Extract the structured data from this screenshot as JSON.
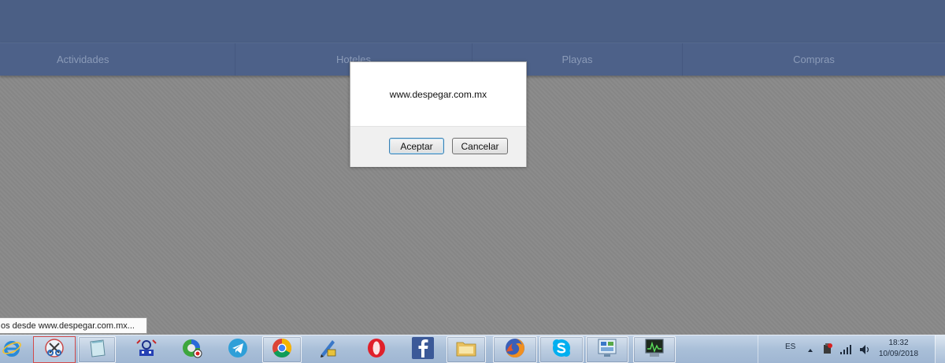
{
  "nav": {
    "items": [
      {
        "label": "Actividades"
      },
      {
        "label": "Hoteles"
      },
      {
        "label": "Playas"
      },
      {
        "label": "Compras"
      }
    ]
  },
  "dialog": {
    "message": "www.despegar.com.mx",
    "accept_label": "Aceptar",
    "cancel_label": "Cancelar"
  },
  "status_bar": {
    "text": "os desde www.despegar.com.mx..."
  },
  "taskbar": {
    "apps": [
      {
        "icon": "internet-explorer-icon"
      },
      {
        "icon": "snipping-tool-icon"
      },
      {
        "icon": "notepad-icon"
      },
      {
        "icon": "network-app-icon"
      },
      {
        "icon": "media-app-icon"
      },
      {
        "icon": "telegram-icon"
      },
      {
        "icon": "chrome-icon"
      },
      {
        "icon": "pen-tool-icon"
      },
      {
        "icon": "opera-icon"
      },
      {
        "icon": "facebook-icon"
      },
      {
        "icon": "file-explorer-icon"
      },
      {
        "icon": "firefox-icon"
      },
      {
        "icon": "skype-icon"
      },
      {
        "icon": "control-panel-icon"
      },
      {
        "icon": "task-manager-icon"
      }
    ],
    "tray": {
      "language": "ES",
      "time": "18:32",
      "date": "10/09/2018"
    }
  },
  "colors": {
    "header": "#4b5f85",
    "nav_text": "#8b9bb8",
    "overlay": "#8a8a8a",
    "accent_button": "#3c7fb1"
  }
}
